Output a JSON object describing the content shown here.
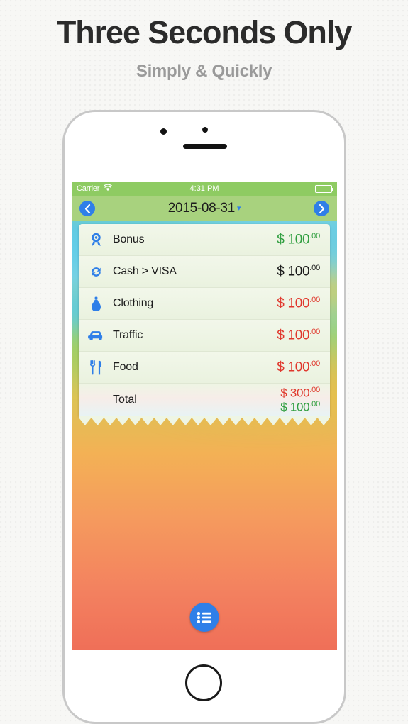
{
  "header": {
    "headline": "Three Seconds Only",
    "subhead": "Simply & Quickly"
  },
  "colors": {
    "accent_blue": "#2f7fe8",
    "status_bar_green": "#8ecb62",
    "nav_bar_green": "#a8d27e",
    "income_green": "#2f9e3f",
    "expense_red": "#e0372c",
    "neutral_black": "#1a1a1a",
    "receipt_bg": "#eef5e4"
  },
  "status_bar": {
    "carrier": "Carrier",
    "wifi_icon": "wifi-icon",
    "time": "4:31 PM",
    "battery_icon": "battery-icon"
  },
  "nav_bar": {
    "back_icon": "chevron-left-icon",
    "forward_icon": "chevron-right-icon",
    "title": "2015-08-31",
    "caret": "▾"
  },
  "receipt": {
    "rows": [
      {
        "icon": "award-ribbon-icon",
        "label": "Bonus",
        "currency": "$",
        "amount": "100",
        "cents": ".00",
        "amount_class": "amt-green"
      },
      {
        "icon": "transfer-arrows-icon",
        "label": "Cash > VISA",
        "currency": "$",
        "amount": "100",
        "cents": ".00",
        "amount_class": "amt-black"
      },
      {
        "icon": "clothing-icon",
        "label": "Clothing",
        "currency": "$",
        "amount": "100",
        "cents": ".00",
        "amount_class": "amt-red"
      },
      {
        "icon": "car-icon",
        "label": "Traffic",
        "currency": "$",
        "amount": "100",
        "cents": ".00",
        "amount_class": "amt-red"
      },
      {
        "icon": "fork-knife-icon",
        "label": "Food",
        "currency": "$",
        "amount": "100",
        "cents": ".00",
        "amount_class": "amt-red"
      }
    ],
    "total": {
      "label": "Total",
      "expense": {
        "currency": "$",
        "amount": "300",
        "cents": ".00"
      },
      "income": {
        "currency": "$",
        "amount": "100",
        "cents": ".00"
      }
    }
  },
  "fab": {
    "icon": "list-icon"
  },
  "phone": {
    "speaker": "speaker-grille",
    "camera": "front-camera",
    "sensor": "proximity-sensor",
    "home": "home-button"
  }
}
